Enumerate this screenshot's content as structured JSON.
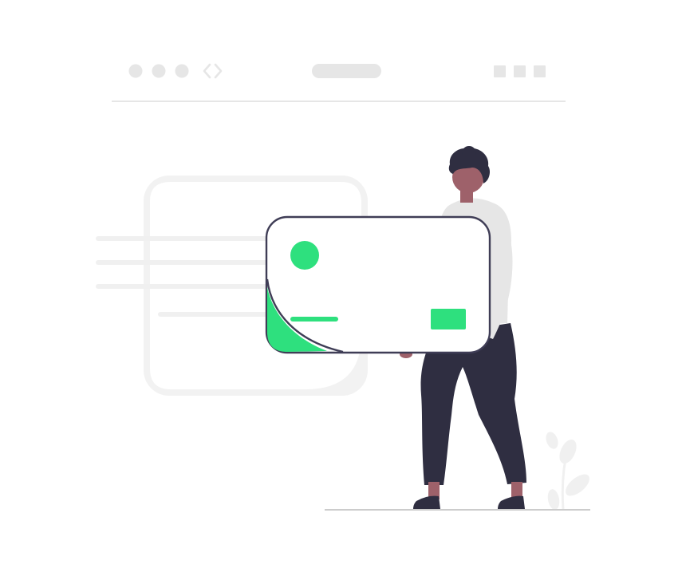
{
  "illustration": {
    "subject": "person-holding-credit-card",
    "colors": {
      "background": "#ffffff",
      "faint_gray": "#f0f0f0",
      "mid_gray": "#e6e6e6",
      "ground_line": "#cccccc",
      "accent_green": "#2ee07e",
      "outline_dark": "#3f3d56",
      "pants_dark": "#2f2e41",
      "skin": "#9e616a",
      "hair": "#2f2e41"
    },
    "browser_bar": {
      "window_dots": 3,
      "window_squares": 3,
      "icons": [
        "circle-dot-icon",
        "chevron-left-icon",
        "chevron-right-icon",
        "square-icon"
      ]
    },
    "card": {
      "has_chip_circle": true,
      "has_label_bar": true,
      "has_button_block": true
    }
  }
}
